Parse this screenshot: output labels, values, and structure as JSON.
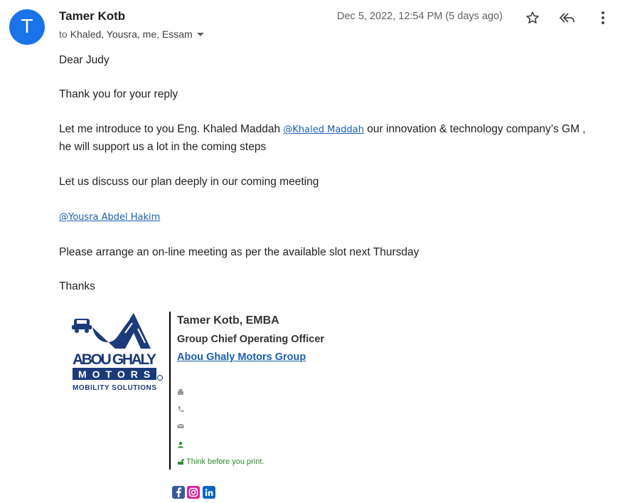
{
  "header": {
    "avatar_initial": "T",
    "sender_name": "Tamer Kotb",
    "to_prefix": "to",
    "recipients": "Khaled, Yousra, me, Essam",
    "date": "Dec 5, 2022, 12:54 PM (5 days ago)",
    "icons": [
      "star-icon",
      "reply-all-icon",
      "more-vert-icon"
    ],
    "accent_color": "#1a73e8"
  },
  "body": {
    "greeting": "Dear Judy",
    "line1": "Thank you for your reply",
    "line2_pre": "Let me introduce to you Eng. Khaled Maddah ",
    "line2_mention": "@Khaled Maddah",
    "line2_post": " our innovation & technology company’s GM ,",
    "line3": "he will support us a lot in the coming steps",
    "line4": "Let us discuss our plan deeply in our coming meeting",
    "mention2": "@Yousra Abdel Hakim",
    "line5": "Please arrange an on-line meeting as per the available slot next Thursday",
    "closing": "Thanks"
  },
  "signature": {
    "logo_line1": "ABOU GHALY",
    "logo_line2": "MOTORS",
    "logo_line3": "MOBILITY SOLUTIONS",
    "name": "Tamer Kotb, EMBA",
    "title": "Group Chief Operating Officer",
    "company": "Abou Ghaly Motors Group",
    "contact_icons": [
      "fax-icon",
      "phone-icon",
      "email-icon",
      "person-icon"
    ],
    "eco_note": "Think before you print.",
    "social": [
      "facebook-icon",
      "instagram-icon",
      "linkedin-icon"
    ],
    "brand_color": "#1b3a7a"
  }
}
